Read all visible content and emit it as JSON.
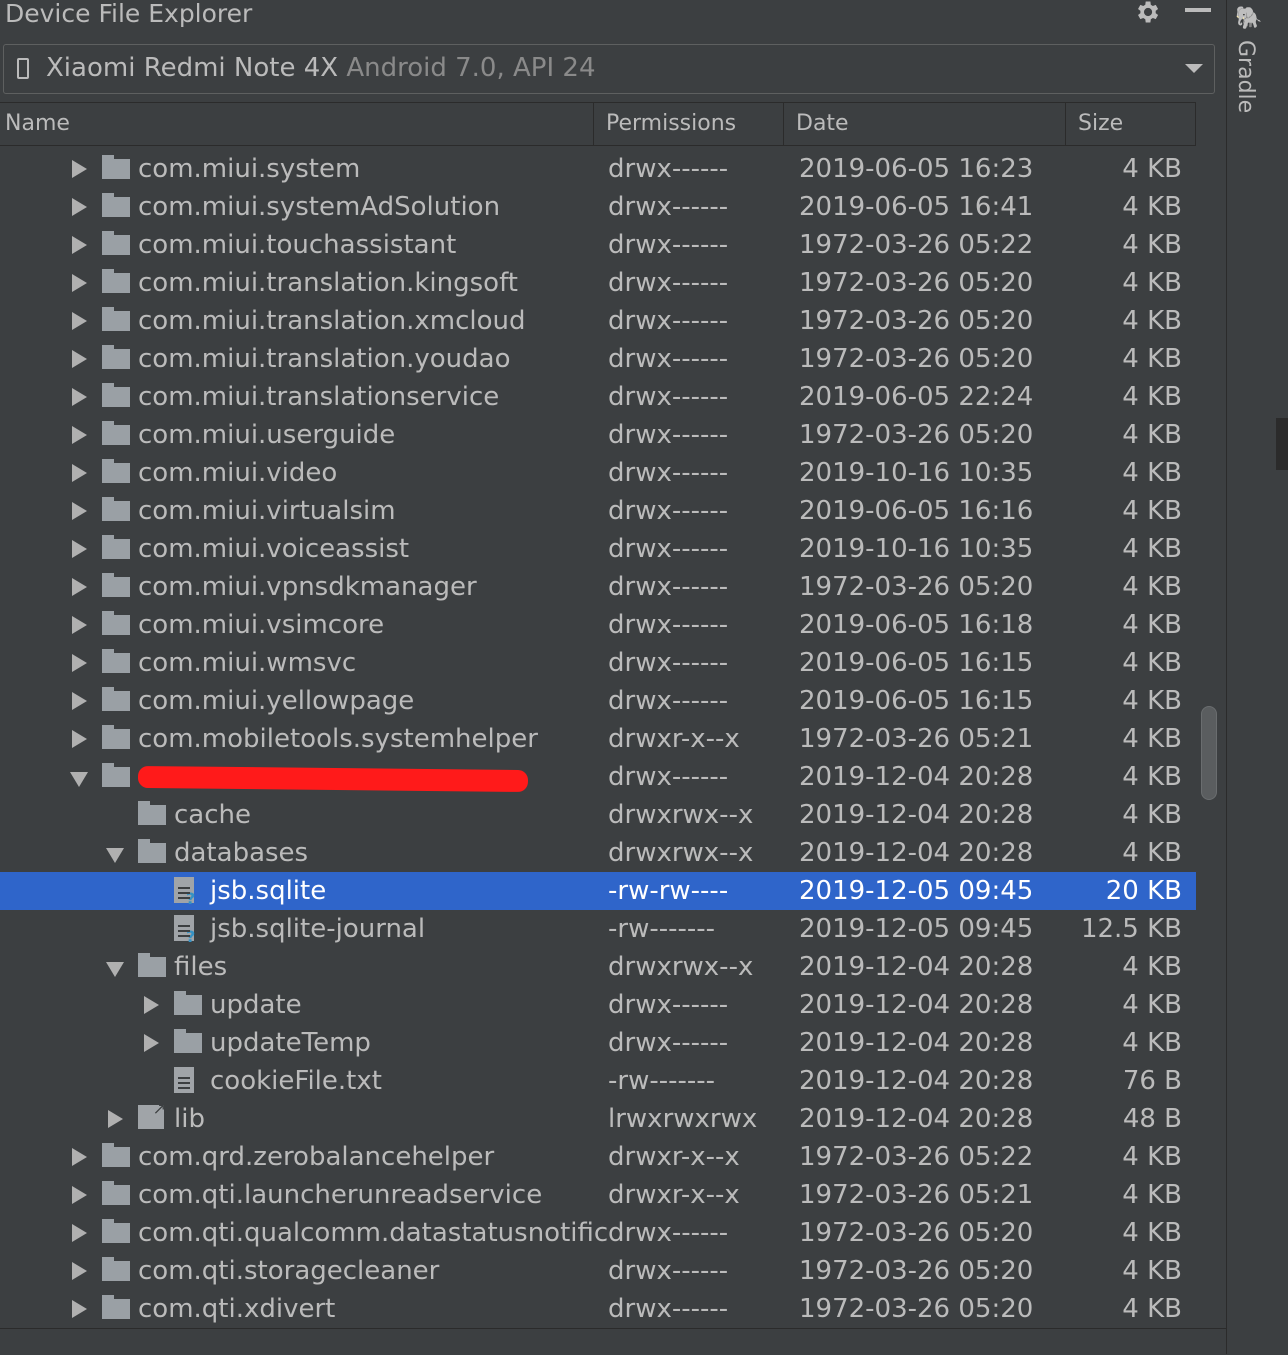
{
  "panel": {
    "title": "Device File Explorer",
    "gear_icon": "gear-icon",
    "minimize_icon": "minimize-icon"
  },
  "device": {
    "name": "Xiaomi Redmi Note 4X",
    "api": "Android 7.0, API 24"
  },
  "columns": {
    "name": "Name",
    "permissions": "Permissions",
    "date": "Date",
    "size": "Size"
  },
  "sidebar": {
    "label": "Gradle",
    "icon": "gradle-icon"
  },
  "colors": {
    "background": "#3c3f41",
    "selection": "#2f65ca",
    "redaction": "#ff1a1a"
  },
  "rows": [
    {
      "name": "com.miui.system",
      "perm": "drwx------",
      "date": "2019-06-05 16:23",
      "size": "4 KB",
      "depth": 0,
      "type": "folder",
      "expand": "collapsed"
    },
    {
      "name": "com.miui.systemAdSolution",
      "perm": "drwx------",
      "date": "2019-06-05 16:41",
      "size": "4 KB",
      "depth": 0,
      "type": "folder",
      "expand": "collapsed"
    },
    {
      "name": "com.miui.touchassistant",
      "perm": "drwx------",
      "date": "1972-03-26 05:22",
      "size": "4 KB",
      "depth": 0,
      "type": "folder",
      "expand": "collapsed"
    },
    {
      "name": "com.miui.translation.kingsoft",
      "perm": "drwx------",
      "date": "1972-03-26 05:20",
      "size": "4 KB",
      "depth": 0,
      "type": "folder",
      "expand": "collapsed"
    },
    {
      "name": "com.miui.translation.xmcloud",
      "perm": "drwx------",
      "date": "1972-03-26 05:20",
      "size": "4 KB",
      "depth": 0,
      "type": "folder",
      "expand": "collapsed"
    },
    {
      "name": "com.miui.translation.youdao",
      "perm": "drwx------",
      "date": "1972-03-26 05:20",
      "size": "4 KB",
      "depth": 0,
      "type": "folder",
      "expand": "collapsed"
    },
    {
      "name": "com.miui.translationservice",
      "perm": "drwx------",
      "date": "2019-06-05 22:24",
      "size": "4 KB",
      "depth": 0,
      "type": "folder",
      "expand": "collapsed"
    },
    {
      "name": "com.miui.userguide",
      "perm": "drwx------",
      "date": "1972-03-26 05:20",
      "size": "4 KB",
      "depth": 0,
      "type": "folder",
      "expand": "collapsed"
    },
    {
      "name": "com.miui.video",
      "perm": "drwx------",
      "date": "2019-10-16 10:35",
      "size": "4 KB",
      "depth": 0,
      "type": "folder",
      "expand": "collapsed"
    },
    {
      "name": "com.miui.virtualsim",
      "perm": "drwx------",
      "date": "2019-06-05 16:16",
      "size": "4 KB",
      "depth": 0,
      "type": "folder",
      "expand": "collapsed"
    },
    {
      "name": "com.miui.voiceassist",
      "perm": "drwx------",
      "date": "2019-10-16 10:35",
      "size": "4 KB",
      "depth": 0,
      "type": "folder",
      "expand": "collapsed"
    },
    {
      "name": "com.miui.vpnsdkmanager",
      "perm": "drwx------",
      "date": "1972-03-26 05:20",
      "size": "4 KB",
      "depth": 0,
      "type": "folder",
      "expand": "collapsed"
    },
    {
      "name": "com.miui.vsimcore",
      "perm": "drwx------",
      "date": "2019-06-05 16:18",
      "size": "4 KB",
      "depth": 0,
      "type": "folder",
      "expand": "collapsed"
    },
    {
      "name": "com.miui.wmsvc",
      "perm": "drwx------",
      "date": "2019-06-05 16:15",
      "size": "4 KB",
      "depth": 0,
      "type": "folder",
      "expand": "collapsed"
    },
    {
      "name": "com.miui.yellowpage",
      "perm": "drwx------",
      "date": "2019-06-05 16:15",
      "size": "4 KB",
      "depth": 0,
      "type": "folder",
      "expand": "collapsed"
    },
    {
      "name": "com.mobiletools.systemhelper",
      "perm": "drwxr-x--x",
      "date": "1972-03-26 05:21",
      "size": "4 KB",
      "depth": 0,
      "type": "folder",
      "expand": "collapsed"
    },
    {
      "name": "",
      "perm": "drwx------",
      "date": "2019-12-04 20:28",
      "size": "4 KB",
      "depth": 0,
      "type": "folder",
      "expand": "expanded",
      "redacted": true
    },
    {
      "name": "cache",
      "perm": "drwxrwx--x",
      "date": "2019-12-04 20:28",
      "size": "4 KB",
      "depth": 1,
      "type": "folder",
      "expand": "none"
    },
    {
      "name": "databases",
      "perm": "drwxrwx--x",
      "date": "2019-12-04 20:28",
      "size": "4 KB",
      "depth": 1,
      "type": "folder",
      "expand": "expanded"
    },
    {
      "name": "jsb.sqlite",
      "perm": "-rw-rw----",
      "date": "2019-12-05 09:45",
      "size": "20 KB",
      "depth": 2,
      "type": "unknown-file",
      "expand": "none",
      "selected": true
    },
    {
      "name": "jsb.sqlite-journal",
      "perm": "-rw-------",
      "date": "2019-12-05 09:45",
      "size": "12.5 KB",
      "depth": 2,
      "type": "unknown-file",
      "expand": "none"
    },
    {
      "name": "files",
      "perm": "drwxrwx--x",
      "date": "2019-12-04 20:28",
      "size": "4 KB",
      "depth": 1,
      "type": "folder",
      "expand": "expanded"
    },
    {
      "name": "update",
      "perm": "drwx------",
      "date": "2019-12-04 20:28",
      "size": "4 KB",
      "depth": 2,
      "type": "folder",
      "expand": "collapsed"
    },
    {
      "name": "updateTemp",
      "perm": "drwx------",
      "date": "2019-12-04 20:28",
      "size": "4 KB",
      "depth": 2,
      "type": "folder",
      "expand": "collapsed"
    },
    {
      "name": "cookieFile.txt",
      "perm": "-rw-------",
      "date": "2019-12-04 20:28",
      "size": "76 B",
      "depth": 2,
      "type": "text-file",
      "expand": "none"
    },
    {
      "name": "lib",
      "perm": "lrwxrwxrwx",
      "date": "2019-12-04 20:28",
      "size": "48 B",
      "depth": 1,
      "type": "link",
      "expand": "collapsed"
    },
    {
      "name": "com.qrd.zerobalancehelper",
      "perm": "drwxr-x--x",
      "date": "1972-03-26 05:22",
      "size": "4 KB",
      "depth": 0,
      "type": "folder",
      "expand": "collapsed"
    },
    {
      "name": "com.qti.launcherunreadservice",
      "perm": "drwxr-x--x",
      "date": "1972-03-26 05:21",
      "size": "4 KB",
      "depth": 0,
      "type": "folder",
      "expand": "collapsed"
    },
    {
      "name": "com.qti.qualcomm.datastatusnotific",
      "perm": "drwx------",
      "date": "1972-03-26 05:20",
      "size": "4 KB",
      "depth": 0,
      "type": "folder",
      "expand": "collapsed"
    },
    {
      "name": "com.qti.storagecleaner",
      "perm": "drwx------",
      "date": "1972-03-26 05:20",
      "size": "4 KB",
      "depth": 0,
      "type": "folder",
      "expand": "collapsed"
    },
    {
      "name": "com.qti.xdivert",
      "perm": "drwx------",
      "date": "1972-03-26 05:20",
      "size": "4 KB",
      "depth": 0,
      "type": "folder",
      "expand": "collapsed"
    }
  ]
}
